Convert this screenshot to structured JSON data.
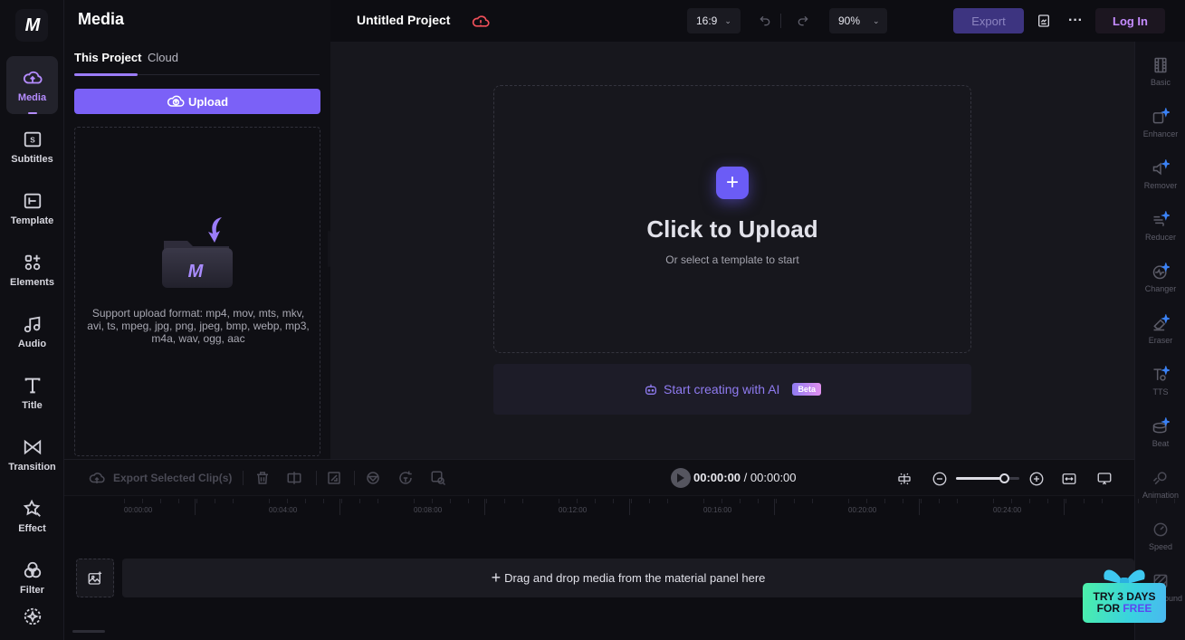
{
  "app": {
    "logo_text": "M"
  },
  "left_rail": {
    "items": [
      {
        "label": "Media",
        "icon": "cloud-upload-icon",
        "active": true
      },
      {
        "label": "Subtitles",
        "icon": "subtitles-icon"
      },
      {
        "label": "Template",
        "icon": "template-icon"
      },
      {
        "label": "Elements",
        "icon": "elements-icon"
      },
      {
        "label": "Audio",
        "icon": "music-note-icon"
      },
      {
        "label": "Title",
        "icon": "title-text-icon"
      },
      {
        "label": "Transition",
        "icon": "transition-bowtie-icon"
      },
      {
        "label": "Effect",
        "icon": "effect-star-icon"
      },
      {
        "label": "Filter",
        "icon": "filter-circles-icon"
      },
      {
        "label": "",
        "icon": "ai-sparkle-icon"
      }
    ]
  },
  "media_panel": {
    "title": "Media",
    "tabs": [
      {
        "label": "This Project",
        "active": true
      },
      {
        "label": "Cloud"
      }
    ],
    "upload_label": "Upload",
    "support_text": "Support upload format: mp4, mov, mts, mkv, avi, ts, mpeg, jpg, png, jpeg, bmp, webp, mp3, m4a, wav, ogg, aac"
  },
  "topbar": {
    "project_title": "Untitled Project",
    "aspect_ratio": "16:9",
    "zoom": "90%",
    "export_label": "Export",
    "login_label": "Log In",
    "more_label": "···"
  },
  "canvas": {
    "upload_title": "Click to Upload",
    "upload_sub": "Or select a template to start",
    "ai_label": "Start creating with AI",
    "ai_badge": "Beta"
  },
  "right_rail": {
    "items": [
      {
        "label": "Basic",
        "icon": "film-icon"
      },
      {
        "label": "Enhancer",
        "icon": "enhancer-icon"
      },
      {
        "label": "Remover",
        "icon": "speaker-remover-icon"
      },
      {
        "label": "Reducer",
        "icon": "noise-reducer-icon"
      },
      {
        "label": "Changer",
        "icon": "voice-changer-icon"
      },
      {
        "label": "Eraser",
        "icon": "eraser-icon"
      },
      {
        "label": "TTS",
        "icon": "tts-icon"
      },
      {
        "label": "Beat",
        "icon": "drum-beat-icon"
      },
      {
        "label": "Animation",
        "icon": "animation-icon"
      },
      {
        "label": "Speed",
        "icon": "speedometer-icon"
      },
      {
        "label": "Background",
        "icon": "background-icon"
      }
    ]
  },
  "timeline": {
    "export_clips_label": "Export Selected Clip(s)",
    "current_time": "00:00:00",
    "total_time": "00:00:00",
    "zoom_level": 0.75,
    "ruler_labels": [
      "00:00:00",
      "00:04:00",
      "00:08:00",
      "00:12:00",
      "00:16:00",
      "00:20:00",
      "00:24:00"
    ],
    "drop_hint": "Drag and drop media from the material panel here"
  },
  "promo": {
    "line1": "TRY 3 DAYS",
    "line2_a": "FOR ",
    "line2_b": "FREE"
  }
}
